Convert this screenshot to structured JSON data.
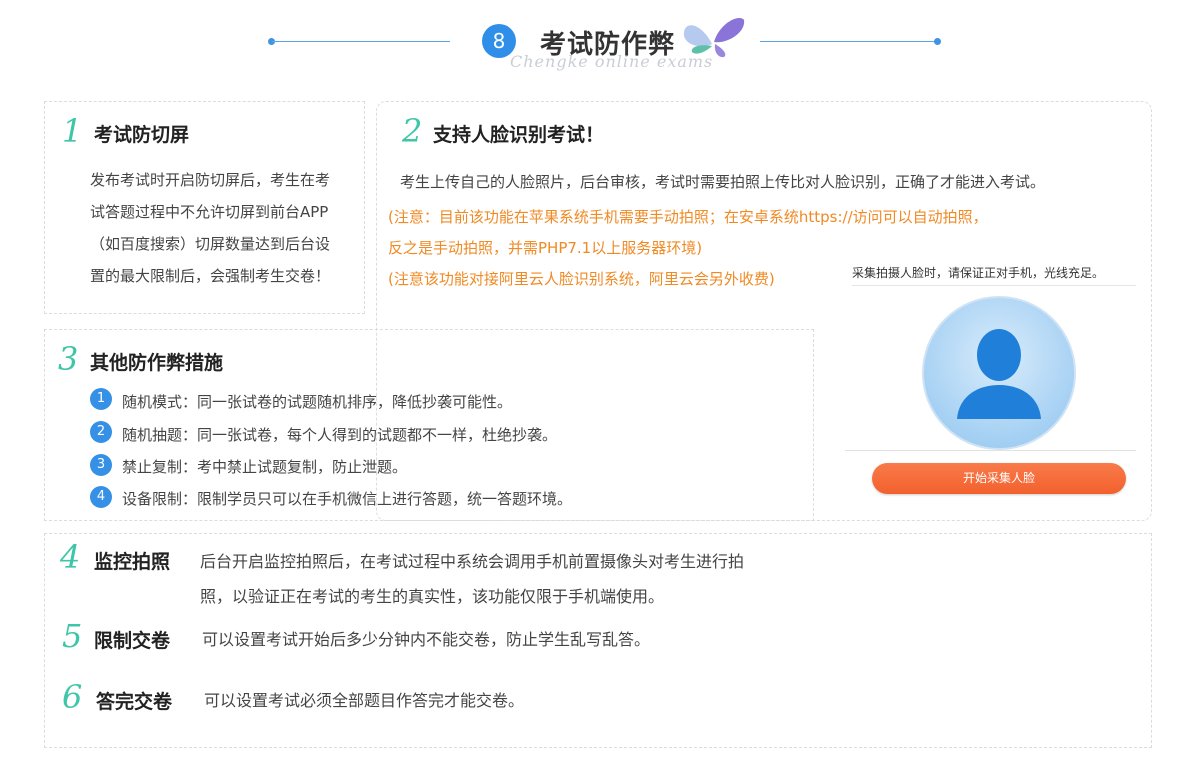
{
  "header": {
    "number": "8",
    "title": "考试防作弊",
    "subtitle": "Chengke online exams"
  },
  "sec1": {
    "num": "1",
    "title": "考试防切屏",
    "lines": [
      "发布考试时开启防切屏后，考生在考",
      "试答题过程中不允许切屏到前台APP",
      "（如百度搜索）切屏数量达到后台设",
      "置的最大限制后，会强制考生交卷！"
    ]
  },
  "sec2": {
    "num": "2",
    "title": "支持人脸识别考试！",
    "desc": "考生上传自己的人脸照片，后台审核，考试时需要拍照上传比对人脸识别，正确了才能进入考试。",
    "note1": "(注意：目前该功能在苹果系统手机需要手动拍照；在安卓系统https://访问可以自动拍照，",
    "note2": "反之是手动拍照，并需PHP7.1以上服务器环境)",
    "note3": "(注意该功能对接阿里云人脸识别系统，阿里云会另外收费)"
  },
  "phone": {
    "hint": "采集拍摄人脸时，请保证正对手机，光线充足。",
    "button": "开始采集人脸"
  },
  "sec3": {
    "num": "3",
    "title": "其他防作弊措施",
    "items": [
      {
        "n": "1",
        "text": "随机模式：同一张试卷的试题随机排序，降低抄袭可能性。"
      },
      {
        "n": "2",
        "text": "随机抽题：同一张试卷，每个人得到的试题都不一样，杜绝抄袭。"
      },
      {
        "n": "3",
        "text": "禁止复制：考中禁止试题复制，防止泄题。"
      },
      {
        "n": "4",
        "text": "设备限制：限制学员只可以在手机微信上进行答题，统一答题环境。"
      }
    ]
  },
  "sec4": {
    "num": "4",
    "title": "监控拍照",
    "line1": "后台开启监控拍照后，在考试过程中系统会调用手机前置摄像头对考生进行拍",
    "line2": "照，以验证正在考试的考生的真实性，该功能仅限于手机端使用。"
  },
  "sec5": {
    "num": "5",
    "title": "限制交卷",
    "text": "可以设置考试开始后多少分钟内不能交卷，防止学生乱写乱答。"
  },
  "sec6": {
    "num": "6",
    "title": "答完交卷",
    "text": "可以设置考试必须全部题目作答完才能交卷。"
  }
}
